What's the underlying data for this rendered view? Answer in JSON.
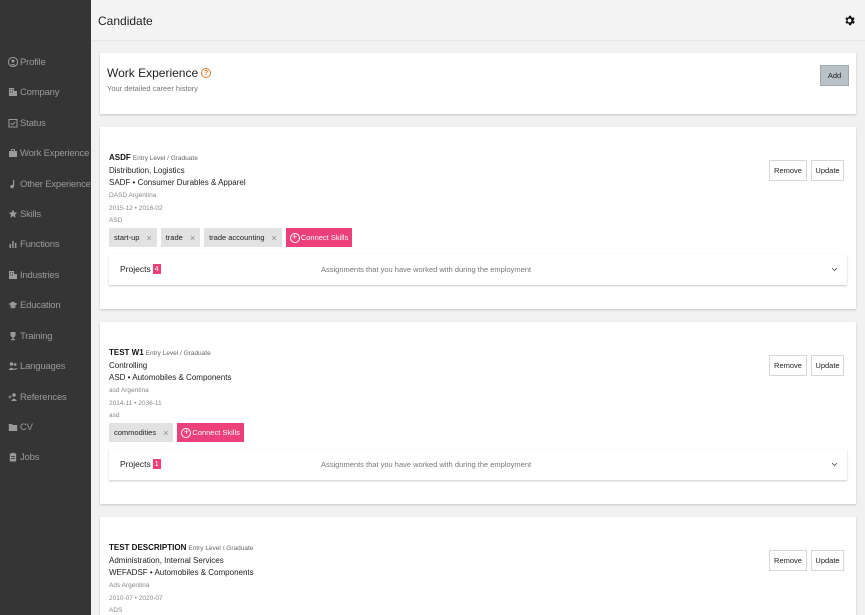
{
  "header": {
    "title": "Candidate"
  },
  "sidebar": {
    "items": [
      {
        "label": "Profile",
        "icon": "person-icon"
      },
      {
        "label": "Company",
        "icon": "building-icon"
      },
      {
        "label": "Status",
        "icon": "status-icon"
      },
      {
        "label": "Work Experience",
        "icon": "briefcase-icon"
      },
      {
        "label": "Other Experience",
        "icon": "music-note-icon"
      },
      {
        "label": "Skills",
        "icon": "star-icon"
      },
      {
        "label": "Functions",
        "icon": "bar-chart-icon"
      },
      {
        "label": "Industries",
        "icon": "building-icon"
      },
      {
        "label": "Education",
        "icon": "graduation-cap-icon"
      },
      {
        "label": "Training",
        "icon": "trophy-icon"
      },
      {
        "label": "Languages",
        "icon": "people-icon"
      },
      {
        "label": "References",
        "icon": "person-add-icon"
      },
      {
        "label": "CV",
        "icon": "folder-icon"
      },
      {
        "label": "Jobs",
        "icon": "clipboard-icon"
      }
    ]
  },
  "work_experience": {
    "title": "Work Experience",
    "subtitle": "Your detailed career history",
    "add_label": "Add"
  },
  "labels": {
    "remove": "Remove",
    "update": "Update",
    "connect_skills": "Connect Skills",
    "projects": "Projects",
    "projects_desc": "Assignments that you have worked with during the employment",
    "chip_close": "×"
  },
  "experiences": [
    {
      "title": "ASDF",
      "level": "Entry Level / Graduate",
      "functions": "Distribution, Logistics",
      "company_industry": "SADF • Consumer Durables & Apparel",
      "location": "DASD Argentina",
      "dates": "2015-12 • 2016-02",
      "description": "ASD",
      "skills": [
        "start-up",
        "trade",
        "trade accounting"
      ],
      "projects_count": "4"
    },
    {
      "title": "TEST W1",
      "level": "Entry Level / Graduate",
      "functions": "Controlling",
      "company_industry": "ASD • Automobiles & Components",
      "location": "asd Argentina",
      "dates": "2014-11 • 2036-11",
      "description": "asd",
      "skills": [
        "commodities"
      ],
      "projects_count": "1"
    },
    {
      "title": "TEST DESCRIPTION",
      "level": "Entry Level / Graduate",
      "functions": "Administration, Internal Services",
      "company_industry": "WEFADSF • Automobiles & Components",
      "location": "Ads Argentina",
      "dates": "2010-07 • 2020-07",
      "description": "ADS"
    }
  ],
  "colors": {
    "accent": "#ec407a",
    "sidebar": "#353535",
    "help": "#e07a2c"
  }
}
